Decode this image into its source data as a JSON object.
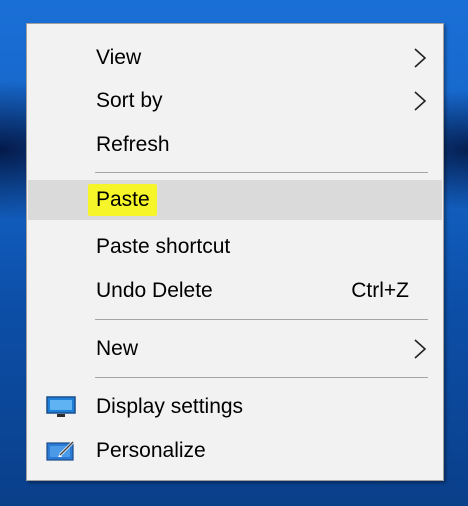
{
  "menu": {
    "view_label": "View",
    "sort_label": "Sort by",
    "refresh_label": "Refresh",
    "paste_label": "Paste",
    "paste_shortcut_label": "Paste shortcut",
    "undo_label": "Undo Delete",
    "undo_shortcut": "Ctrl+Z",
    "new_label": "New",
    "display_label": "Display settings",
    "personalize_label": "Personalize"
  },
  "colors": {
    "highlight": "#f5f52a",
    "selected_row": "#dadada",
    "menu_bg": "#f2f2f2"
  },
  "icons": {
    "submenu": "chevron-right-icon",
    "display": "monitor-icon",
    "personalize": "paintbrush-icon"
  }
}
